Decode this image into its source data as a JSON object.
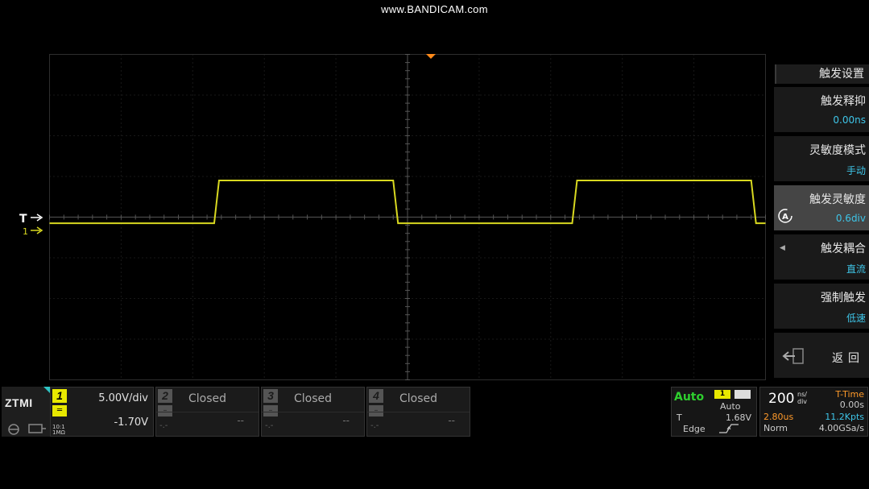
{
  "watermark": "www.BANDICAM.com",
  "colors": {
    "ch1_trace": "#d8d820",
    "accent_value": "#3ec5e8",
    "trigger_mode": "#2ecf2e",
    "time_marker": "#ff9a2a"
  },
  "markers": {
    "trigger_level": "T",
    "ch1_ground": "1"
  },
  "trigger_menu": {
    "title": "触发设置",
    "items": [
      {
        "label": "触发释抑",
        "value": "0.00ns"
      },
      {
        "label": "灵敏度模式",
        "value": "手动"
      },
      {
        "label": "触发灵敏度",
        "value": "0.6div"
      },
      {
        "label": "触发耦合",
        "value": "直流"
      },
      {
        "label": "强制触发",
        "value": "低速"
      }
    ],
    "back_label": "返回"
  },
  "logo": "ZTMI",
  "channels": {
    "ch1": {
      "number": "1",
      "scale": "5.00V/div",
      "offset": "-1.70V",
      "impedance_line1": "10:1",
      "impedance_line2": "1MΩ"
    },
    "ch2": {
      "number": "2",
      "status": "Closed",
      "value": "--",
      "sub": "-.-"
    },
    "ch3": {
      "number": "3",
      "status": "Closed",
      "value": "--",
      "sub": "-.-"
    },
    "ch4": {
      "number": "4",
      "status": "Closed",
      "value": "--",
      "sub": "-.-"
    }
  },
  "trigger_status": {
    "mode": "Auto",
    "source": "1",
    "sweep": "Auto",
    "level_label": "T",
    "level_value": "1.68V",
    "type": "Edge"
  },
  "timebase": {
    "scale_value": "200",
    "scale_unit_top": "ns/",
    "scale_unit_bottom": "div",
    "t_time_label": "T-Time",
    "t_time_value": "0.00s",
    "delay": "2.80us",
    "points": "11.2Kpts",
    "acquisition": "Norm",
    "sample_rate": "4.00GSa/s"
  },
  "waveform": {
    "period_divisions": 5.0,
    "high_level_divisions": 0.9,
    "low_level_divisions": -0.15,
    "first_rising_edge_division": 2.3
  }
}
